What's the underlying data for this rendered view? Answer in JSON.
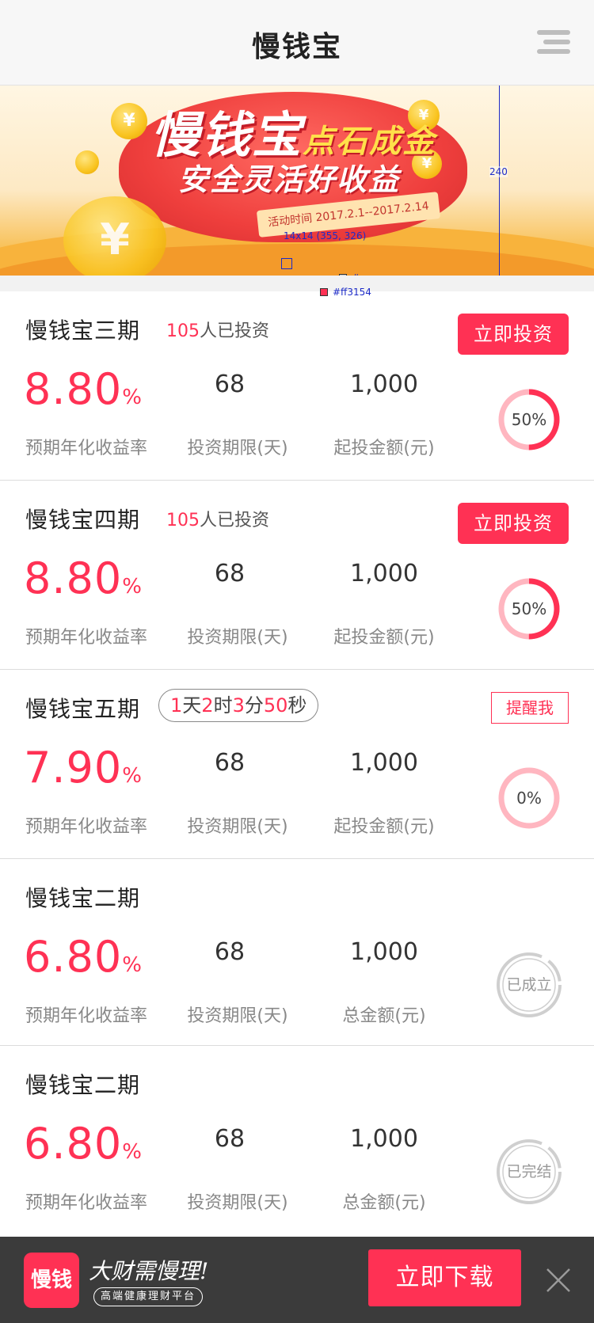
{
  "header": {
    "title": "慢钱宝",
    "menu_icon": "hamburger-menu-icon"
  },
  "banner": {
    "title_main": "慢钱宝",
    "title_accent": "点石成金",
    "subtitle": "安全灵活好收益",
    "date_text": "活动时间 2017.2.1--2017.2.14",
    "annotation_size": "14x14 (355, 326)",
    "annotation_gray": "#cccccc",
    "annotation_red": "#ff3154",
    "annotation_height": "240"
  },
  "colors": {
    "accent": "#ff3154",
    "ring_track": "#ffb6c0",
    "stamp": "#cfcfcf"
  },
  "products": [
    {
      "name": "慢钱宝三期",
      "investor_count": "105",
      "investor_suffix": "人已投资",
      "action_label": "立即投资",
      "rate": "8.80",
      "rate_unit": "%",
      "rate_label": "预期年化收益率",
      "days": "68",
      "days_label": "投资期限(天)",
      "amount": "1,000",
      "amount_label": "起投金额(元)",
      "progress_text": "50%",
      "progress": 0.5
    },
    {
      "name": "慢钱宝四期",
      "investor_count": "105",
      "investor_suffix": "人已投资",
      "action_label": "立即投资",
      "rate": "8.80",
      "rate_unit": "%",
      "rate_label": "预期年化收益率",
      "days": "68",
      "days_label": "投资期限(天)",
      "amount": "1,000",
      "amount_label": "起投金额(元)",
      "progress_text": "50%",
      "progress": 0.5
    },
    {
      "name": "慢钱宝五期",
      "countdown": {
        "d": "1",
        "d_unit": "天",
        "h": "2",
        "h_unit": "时",
        "m": "3",
        "m_unit": "分",
        "s": "50",
        "s_unit": "秒"
      },
      "action_label": "提醒我",
      "rate": "7.90",
      "rate_unit": "%",
      "rate_label": "预期年化收益率",
      "days": "68",
      "days_label": "投资期限(天)",
      "amount": "1,000",
      "amount_label": "起投金额(元)",
      "progress_text": "0%",
      "progress": 0
    },
    {
      "name": "慢钱宝二期",
      "rate": "6.80",
      "rate_unit": "%",
      "rate_label": "预期年化收益率",
      "days": "68",
      "days_label": "投资期限(天)",
      "amount": "1,000",
      "amount_label": "总金额(元)",
      "status_text": "已成立"
    },
    {
      "name": "慢钱宝二期",
      "rate": "6.80",
      "rate_unit": "%",
      "rate_label": "预期年化收益率",
      "days": "68",
      "days_label": "投资期限(天)",
      "amount": "1,000",
      "amount_label": "总金额(元)",
      "status_text": "已完结"
    }
  ],
  "footer": {
    "logo_text": "慢钱",
    "slogan": "大财需慢理!",
    "slogan_sub": "高端健康理财平台",
    "download_label": "立即下载",
    "close_icon": "close-icon"
  }
}
